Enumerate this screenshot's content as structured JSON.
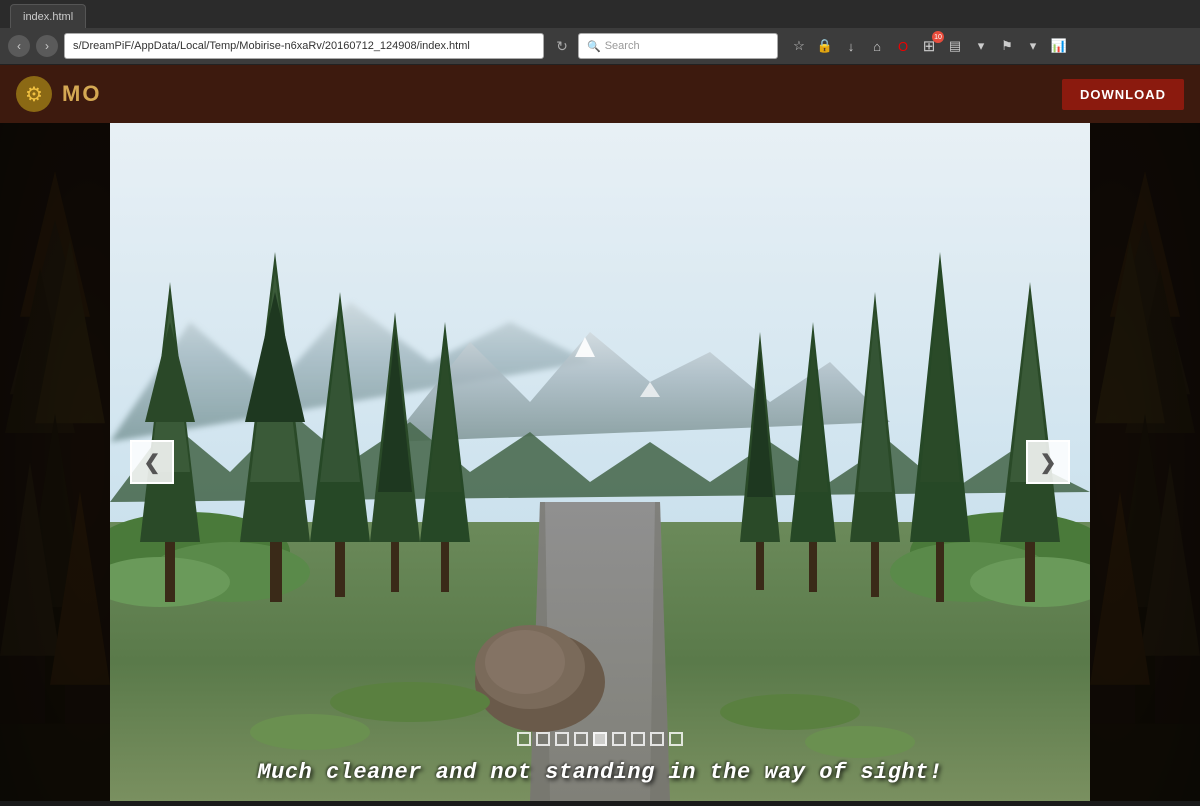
{
  "browser": {
    "address": "s/DreamPiF/AppData/Local/Temp/Mobirise-n6xaRv/20160712_124908/index.html",
    "search_placeholder": "Search",
    "reload_icon": "↻",
    "tab_label": "index.html"
  },
  "toolbar": {
    "back_icon": "‹",
    "forward_icon": "›",
    "home_icon": "⌂",
    "bookmark_icon": "☆",
    "lock_icon": "🔒",
    "download_icon": "↓",
    "badge_count": "10"
  },
  "app": {
    "name": "MO",
    "download_label": "DOWNLOAD"
  },
  "slideshow": {
    "caption": "Much cleaner and not standing in the way of sight!",
    "indicators": [
      {
        "active": false
      },
      {
        "active": false
      },
      {
        "active": false
      },
      {
        "active": false
      },
      {
        "active": true
      },
      {
        "active": false
      },
      {
        "active": false
      },
      {
        "active": false
      },
      {
        "active": false
      }
    ],
    "prev_label": "❮",
    "next_label": "❯"
  }
}
